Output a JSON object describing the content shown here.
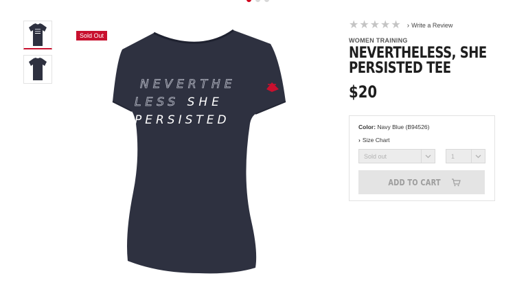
{
  "carousel": {
    "dots": 3,
    "active": 0
  },
  "gallery": {
    "thumbnails": [
      {
        "name": "thumb-front",
        "active": true
      },
      {
        "name": "thumb-back",
        "active": false
      }
    ],
    "badge": "Sold Out",
    "shirt_text": {
      "line1": "NEVERTHE",
      "line2_outline": "LESS",
      "line2_solid": "SHE",
      "line3": "PERSISTED"
    },
    "colors": {
      "shirt": "#2e3140",
      "logo": "#c8102e"
    }
  },
  "product": {
    "rating_stars": 5,
    "rating_value": 0,
    "write_review": "Write a Review",
    "category": "WOMEN TRAINING",
    "title": "NEVERTHELESS, SHE PERSISTED TEE",
    "price": "$20",
    "color_label": "Color:",
    "color_value": "Navy Blue (B94526)",
    "size_chart": "Size Chart",
    "size_select": {
      "value": "Sold out"
    },
    "qty_select": {
      "value": "1"
    },
    "add_to_cart": "ADD TO CART",
    "accent": "#c8102e"
  }
}
